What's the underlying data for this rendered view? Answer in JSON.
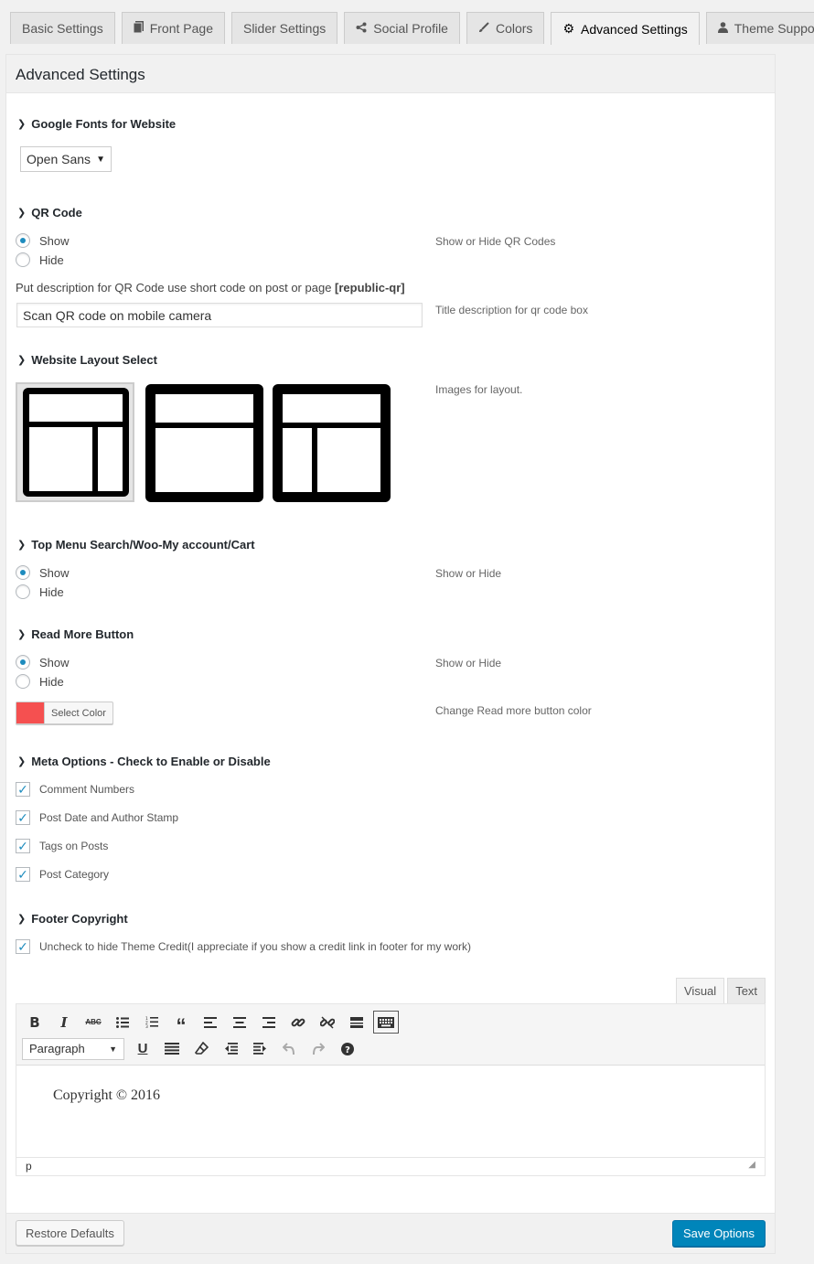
{
  "tabs": [
    {
      "label": "Basic Settings",
      "icon": ""
    },
    {
      "label": "Front Page",
      "icon": "page-icon"
    },
    {
      "label": "Slider Settings",
      "icon": ""
    },
    {
      "label": "Social Profile",
      "icon": "share-icon"
    },
    {
      "label": "Colors",
      "icon": "brush-icon"
    },
    {
      "label": "Advanced Settings",
      "icon": "gear-icon",
      "active": true
    },
    {
      "label": "Theme Support",
      "icon": "user-icon"
    }
  ],
  "panel": {
    "title": "Advanced Settings"
  },
  "google_fonts": {
    "title": "Google Fonts for Website",
    "selected": "Open Sans"
  },
  "qr_code": {
    "title": "QR Code",
    "show_label": "Show",
    "hide_label": "Hide",
    "selected": "Show",
    "description": "Show or Hide QR Codes",
    "field_label_prefix": "Put description for QR Code use short code on post or page ",
    "shortcode": "[republic-qr]",
    "field_value": "Scan QR code on mobile camera",
    "field_description": "Title description for qr code box"
  },
  "layout": {
    "title": "Website Layout Select",
    "description": "Images for layout.",
    "options": [
      "left-sidebar-right-narrow",
      "full-width",
      "left-narrow-sidebar"
    ],
    "selected_index": 0
  },
  "top_menu": {
    "title": "Top Menu Search/Woo-My account/Cart",
    "show_label": "Show",
    "hide_label": "Hide",
    "selected": "Show",
    "description": "Show or Hide"
  },
  "read_more": {
    "title": "Read More Button",
    "show_label": "Show",
    "hide_label": "Hide",
    "selected": "Show",
    "description": "Show or Hide",
    "color_button_label": "Select Color",
    "color": "#f55050",
    "color_description": "Change Read more button color"
  },
  "meta": {
    "title": "Meta Options - Check to Enable or Disable",
    "items": [
      {
        "label": "Comment Numbers",
        "checked": true
      },
      {
        "label": "Post Date and Author Stamp",
        "checked": true
      },
      {
        "label": "Tags on Posts",
        "checked": true
      },
      {
        "label": "Post Category",
        "checked": true
      }
    ]
  },
  "footer_copyright": {
    "title": "Footer Copyright",
    "credit_label": "Uncheck to hide Theme Credit(I appreciate if you show a credit link in footer for my work)",
    "credit_checked": true
  },
  "editor": {
    "visual_tab": "Visual",
    "text_tab": "Text",
    "format_select": "Paragraph",
    "content": "Copyright © 2016",
    "status_path": "p"
  },
  "actions": {
    "restore": "Restore Defaults",
    "save": "Save Options"
  },
  "colors": {
    "primary": "#0085ba",
    "radio_accent": "#1e8cbe"
  }
}
